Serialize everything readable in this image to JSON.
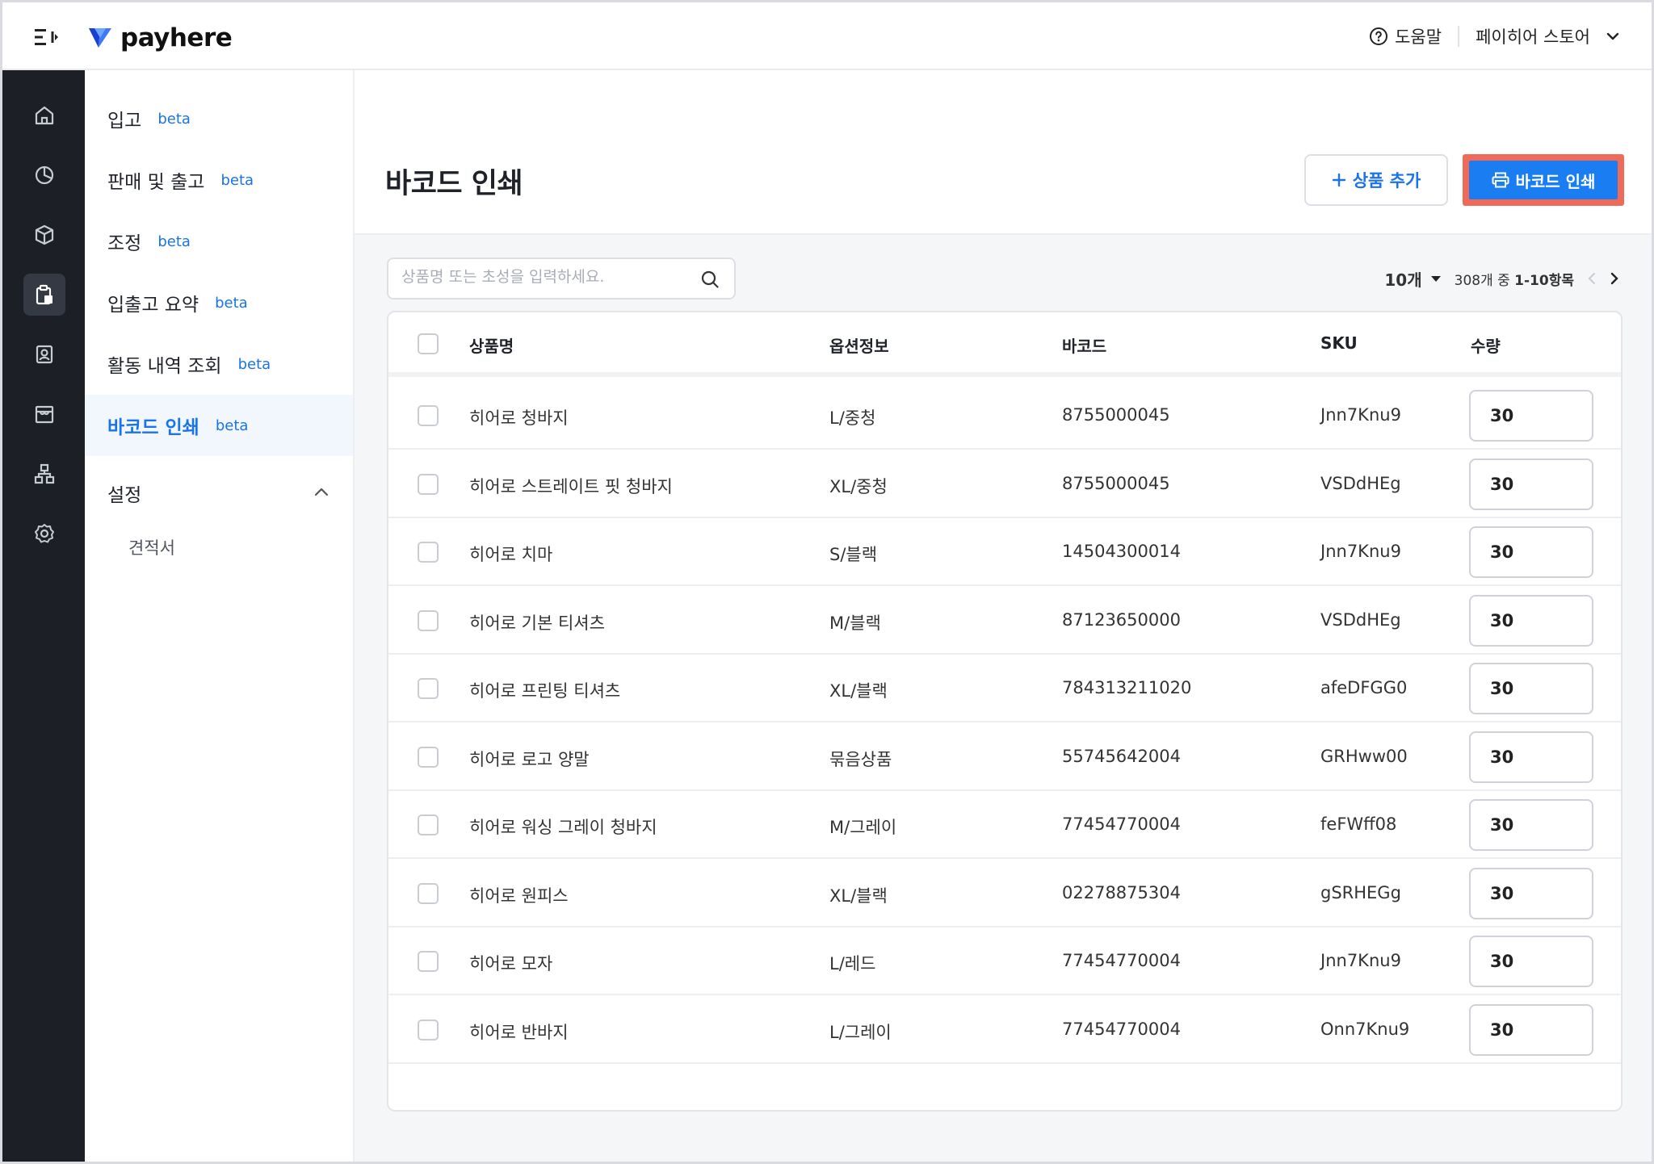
{
  "header": {
    "brand": "payhere",
    "help_label": "도움말",
    "store_name": "페이히어 스토어"
  },
  "rail": {
    "icons": [
      "home-icon",
      "chart-icon",
      "box-icon",
      "clipboard-icon",
      "contacts-icon",
      "store-icon",
      "org-chart-icon",
      "gear-icon"
    ],
    "active_index": 3
  },
  "subnav": {
    "items": [
      {
        "label": "입고",
        "badge": "beta"
      },
      {
        "label": "판매 및 출고",
        "badge": "beta"
      },
      {
        "label": "조정",
        "badge": "beta"
      },
      {
        "label": "입출고 요약",
        "badge": "beta"
      },
      {
        "label": "활동 내역 조회",
        "badge": "beta"
      },
      {
        "label": "바코드 인쇄",
        "badge": "beta"
      }
    ],
    "active_index": 5,
    "section_label": "설정",
    "section_sub": "견적서"
  },
  "page": {
    "title": "바코드 인쇄",
    "add_button": "상품 추가",
    "print_button": "바코드 인쇄",
    "search_placeholder": "상품명 또는 초성을 입력하세요.",
    "per_page": "10개",
    "range_prefix": "308개 중 ",
    "range_value": "1-10항목"
  },
  "table": {
    "columns": [
      "상품명",
      "옵션정보",
      "바코드",
      "SKU",
      "수량"
    ],
    "rows": [
      {
        "name": "히어로 청바지",
        "option": "L/중청",
        "barcode": "8755000045",
        "sku": "Jnn7Knu9",
        "qty": "30"
      },
      {
        "name": "히어로 스트레이트 핏 청바지",
        "option": "XL/중청",
        "barcode": "8755000045",
        "sku": "VSDdHEg",
        "qty": "30"
      },
      {
        "name": "히어로 치마",
        "option": "S/블랙",
        "barcode": "14504300014",
        "sku": "Jnn7Knu9",
        "qty": "30"
      },
      {
        "name": "히어로 기본 티셔츠",
        "option": "M/블랙",
        "barcode": "87123650000",
        "sku": "VSDdHEg",
        "qty": "30"
      },
      {
        "name": "히어로 프린팅 티셔츠",
        "option": "XL/블랙",
        "barcode": "784313211020",
        "sku": "afeDFGG0",
        "qty": "30"
      },
      {
        "name": "히어로 로고 양말",
        "option": "묶음상품",
        "barcode": "55745642004",
        "sku": "GRHww00",
        "qty": "30"
      },
      {
        "name": "히어로 워싱 그레이 청바지",
        "option": "M/그레이",
        "barcode": "77454770004",
        "sku": "feFWff08",
        "qty": "30"
      },
      {
        "name": "히어로 원피스",
        "option": "XL/블랙",
        "barcode": "02278875304",
        "sku": "gSRHEGg",
        "qty": "30"
      },
      {
        "name": "히어로 모자",
        "option": "L/레드",
        "barcode": "77454770004",
        "sku": "Jnn7Knu9",
        "qty": "30"
      },
      {
        "name": "히어로 반바지",
        "option": "L/그레이",
        "barcode": "77454770004",
        "sku": "Onn7Knu9",
        "qty": "30"
      }
    ]
  },
  "colors": {
    "accent": "#1a7ef2",
    "highlight_border": "#f06a5a",
    "rail_bg": "#1c1f26"
  }
}
